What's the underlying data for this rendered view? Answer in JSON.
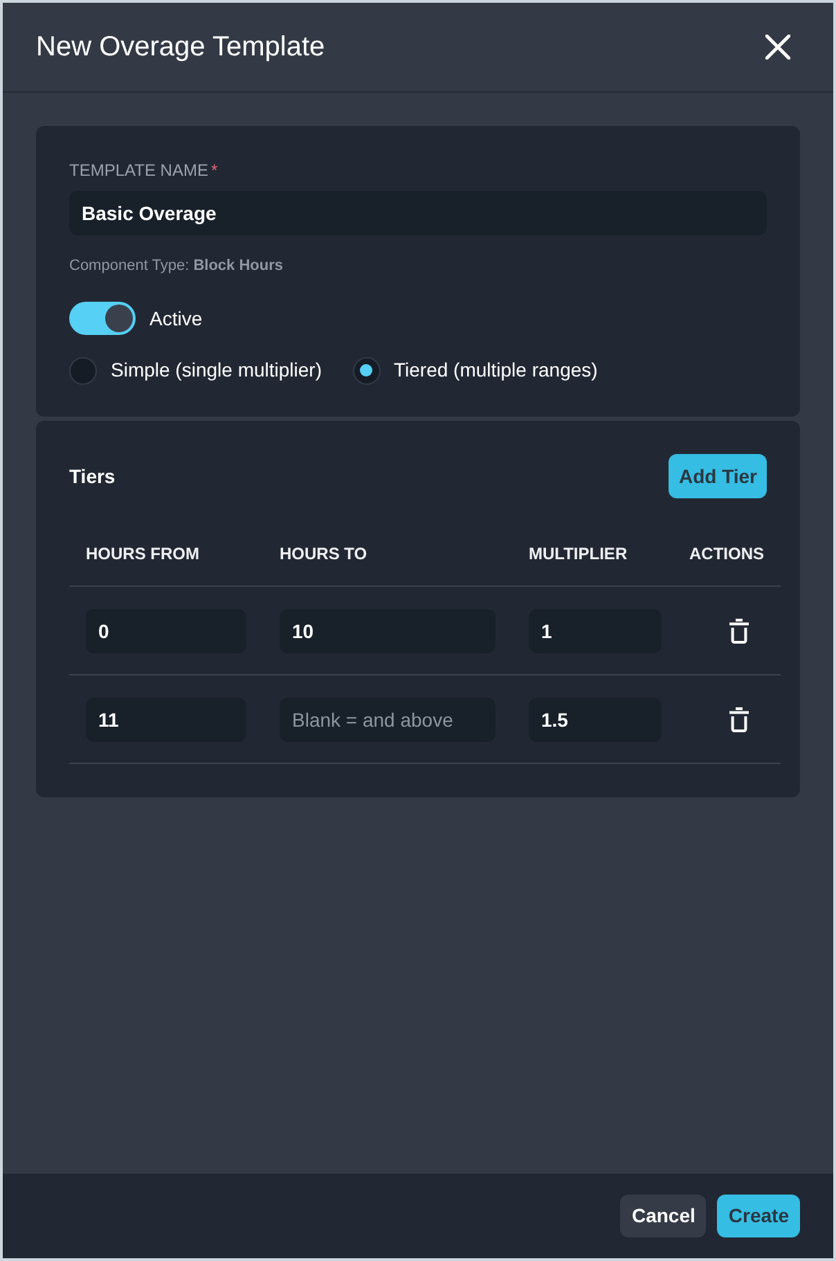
{
  "dialog": {
    "title": "New Overage Template"
  },
  "settings": {
    "name_field": {
      "label": "TEMPLATE NAME",
      "required_mark": "*",
      "value": "Basic Overage"
    },
    "component_type": "Component Type: **Block Hours**",
    "active_toggle": {
      "label": "Active",
      "on": true
    },
    "mode_options": [
      {
        "label": "Simple (single multiplier)",
        "selected": false
      },
      {
        "label": "Tiered (multiple ranges)",
        "selected": true
      }
    ]
  },
  "tiers": {
    "title": "Tiers",
    "add_button": "Add Tier",
    "columns": [
      "HOURS FROM",
      "HOURS TO",
      "MULTIPLIER",
      "ACTIONS"
    ],
    "rows": [
      {
        "cells": [
          {
            "value": "0"
          },
          {
            "value": "10"
          },
          {
            "value": "1"
          }
        ]
      },
      {
        "cells": [
          {
            "value": "11"
          },
          {
            "placeholder": "Blank = and above"
          },
          {
            "value": "1.5"
          }
        ]
      }
    ]
  },
  "footer": {
    "buttons": [
      {
        "label": "Cancel",
        "kind": "secondary"
      },
      {
        "label": "Create",
        "kind": "primary"
      }
    ]
  }
}
